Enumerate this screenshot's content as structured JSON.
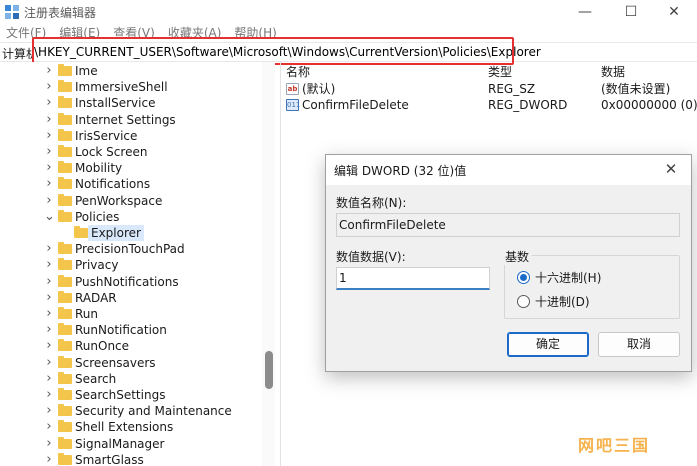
{
  "window": {
    "title": "注册表编辑器",
    "controls": {
      "minimize": "—",
      "maximize": "☐",
      "close": "✕"
    }
  },
  "menu": [
    "文件(F)",
    "编辑(E)",
    "查看(V)",
    "收藏夹(A)",
    "帮助(H)"
  ],
  "address": {
    "prefix": "计算机",
    "path": "\\HKEY_CURRENT_USER\\Software\\Microsoft\\Windows\\CurrentVersion\\Policies\\Explorer",
    "highlight_color": "#e5302f"
  },
  "tree": {
    "items": [
      {
        "label": "Ime",
        "expander": ">",
        "level": 0
      },
      {
        "label": "ImmersiveShell",
        "expander": ">",
        "level": 0
      },
      {
        "label": "InstallService",
        "expander": ">",
        "level": 0
      },
      {
        "label": "Internet Settings",
        "expander": ">",
        "level": 0
      },
      {
        "label": "IrisService",
        "expander": ">",
        "level": 0
      },
      {
        "label": "Lock Screen",
        "expander": ">",
        "level": 0
      },
      {
        "label": "Mobility",
        "expander": ">",
        "level": 0
      },
      {
        "label": "Notifications",
        "expander": ">",
        "level": 0
      },
      {
        "label": "PenWorkspace",
        "expander": ">",
        "level": 0
      },
      {
        "label": "Policies",
        "expander": "v",
        "level": 0
      },
      {
        "label": "Explorer",
        "expander": "",
        "level": 1,
        "selected": true
      },
      {
        "label": "PrecisionTouchPad",
        "expander": ">",
        "level": 0
      },
      {
        "label": "Privacy",
        "expander": ">",
        "level": 0
      },
      {
        "label": "PushNotifications",
        "expander": ">",
        "level": 0
      },
      {
        "label": "RADAR",
        "expander": ">",
        "level": 0
      },
      {
        "label": "Run",
        "expander": ">",
        "level": 0
      },
      {
        "label": "RunNotification",
        "expander": ">",
        "level": 0
      },
      {
        "label": "RunOnce",
        "expander": ">",
        "level": 0
      },
      {
        "label": "Screensavers",
        "expander": ">",
        "level": 0
      },
      {
        "label": "Search",
        "expander": ">",
        "level": 0
      },
      {
        "label": "SearchSettings",
        "expander": ">",
        "level": 0
      },
      {
        "label": "Security and Maintenance",
        "expander": ">",
        "level": 0
      },
      {
        "label": "Shell Extensions",
        "expander": ">",
        "level": 0
      },
      {
        "label": "SignalManager",
        "expander": ">",
        "level": 0
      },
      {
        "label": "SmartGlass",
        "expander": ">",
        "level": 0
      }
    ]
  },
  "list": {
    "columns": {
      "name": "名称",
      "type": "类型",
      "data": "数据"
    },
    "rows": [
      {
        "icon": "string-value-icon",
        "icon_text": "ab",
        "name": "(默认)",
        "type": "REG_SZ",
        "data": "(数值未设置)"
      },
      {
        "icon": "dword-value-icon",
        "icon_text": "011",
        "name": "ConfirmFileDelete",
        "type": "REG_DWORD",
        "data": "0x00000000 (0)"
      }
    ]
  },
  "dialog": {
    "title": "编辑 DWORD (32 位)值",
    "close": "✕",
    "name_label": "数值名称(N):",
    "name_value": "ConfirmFileDelete",
    "data_label": "数值数据(V):",
    "data_value": "1",
    "base_label": "基数",
    "base_options": [
      {
        "label": "十六进制(H)",
        "checked": true
      },
      {
        "label": "十进制(D)",
        "checked": false
      }
    ],
    "ok": "确定",
    "cancel": "取消",
    "accent_color": "#1b6ac8"
  },
  "watermark": "网吧三国"
}
